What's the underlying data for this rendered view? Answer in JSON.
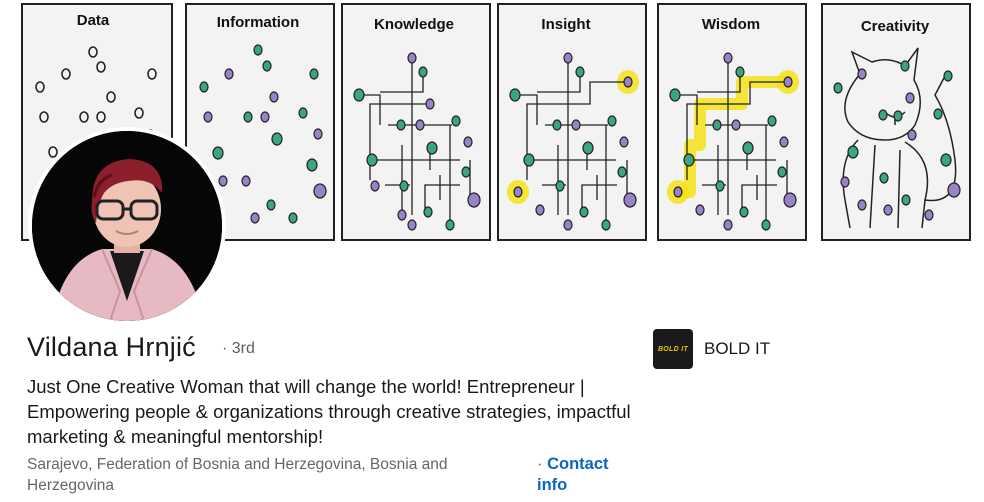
{
  "banner": {
    "panels": [
      "Data",
      "Information",
      "Knowledge",
      "Insight",
      "Wisdom",
      "Creativity"
    ]
  },
  "profile": {
    "name": "Vildana Hrnjić",
    "degree": "· 3rd",
    "headline": "Just One Creative Woman that will change the world! Entrepreneur | Empowering people & organizations through creative strategies, impactful marketing & meaningful mentorship!",
    "location": "Sarajevo, Federation of Bosnia and Herzegovina, Bosnia and Herzegovina",
    "contact_dot": "·",
    "contact_label": "Contact info"
  },
  "company": {
    "logo_text": "BOLD IT",
    "name": "BOLD IT"
  },
  "colors": {
    "link": "#0a66c2",
    "teal_dot": "#3aa57f",
    "purple_dot": "#9a82c8",
    "highlight": "#f5e216"
  }
}
